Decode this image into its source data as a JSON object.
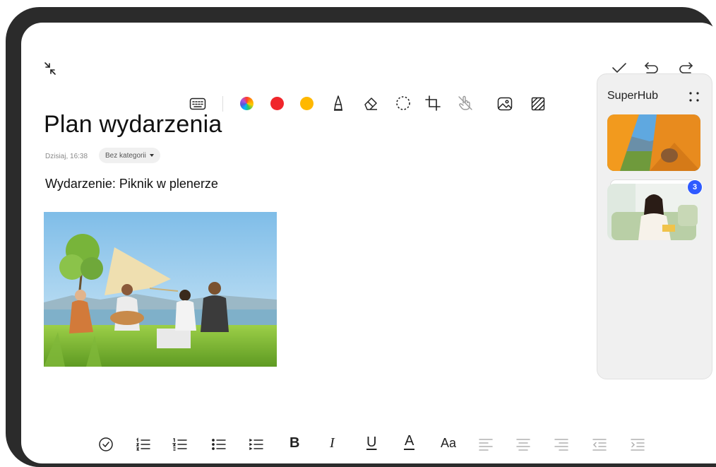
{
  "note": {
    "title": "Plan wydarzenia",
    "timestamp": "Dzisiaj, 16:38",
    "category": "Bez kategorii",
    "subtitle": "Wydarzenie: Piknik w plenerze"
  },
  "top_actions": {
    "left_icon": "collapse-icon",
    "right_icons": [
      "check-icon",
      "undo-icon",
      "redo-icon"
    ]
  },
  "draw_toolbar": {
    "items": [
      "keyboard-icon",
      "color-wheel",
      "red-color",
      "yellow-color",
      "pen-icon",
      "eraser-icon",
      "lasso-icon",
      "crop-icon",
      "hand-off-icon",
      "image-icon",
      "pattern-icon"
    ],
    "colors": {
      "red": "#f0262b",
      "yellow": "#ffb800"
    }
  },
  "superhub": {
    "title": "SuperHub",
    "badge_count": "3"
  },
  "format_toolbar": {
    "bold_label": "B",
    "italic_label": "I",
    "underline_label": "U",
    "text_color_label": "A",
    "font_size_label": "Aa",
    "items": [
      "checklist-icon",
      "numbered-list-icon",
      "numbered-list-alt-icon",
      "bullet-list-icon",
      "bullet-list-alt-icon",
      "bold-button",
      "italic-button",
      "underline-button",
      "text-color-button",
      "font-size-button",
      "align-left-icon",
      "align-center-icon",
      "align-right-icon",
      "outdent-icon",
      "indent-icon"
    ]
  }
}
